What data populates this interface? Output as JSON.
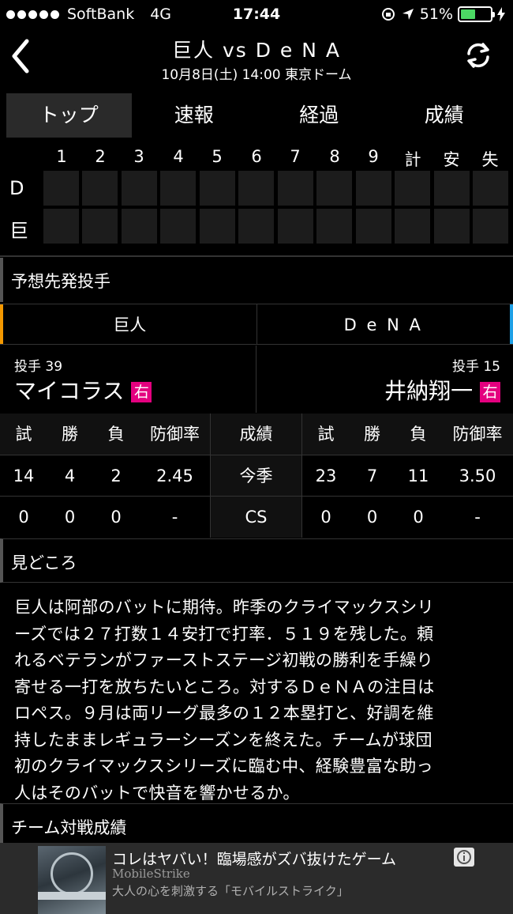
{
  "status": {
    "carrier": "SoftBank",
    "network": "4G",
    "time": "17:44",
    "battery": "51%",
    "battery_level": 0.51
  },
  "header": {
    "title": "巨人 vs D e N A",
    "subtitle": "10月8日(土) 14:00 東京ドーム"
  },
  "tabs": [
    "トップ",
    "速報",
    "経過",
    "成績"
  ],
  "scoreboard": {
    "columns": [
      "1",
      "2",
      "3",
      "4",
      "5",
      "6",
      "7",
      "8",
      "9",
      "計",
      "安",
      "失"
    ],
    "rows": [
      "D",
      "巨"
    ]
  },
  "pitchers_section": {
    "title": "予想先発投手"
  },
  "teams": {
    "home": "巨人",
    "away": "D e N A"
  },
  "pitchers": {
    "home": {
      "number": "投手  39",
      "name": "マイコラス",
      "hand": "右"
    },
    "away": {
      "number": "投手  15",
      "name": "井納翔一",
      "hand": "右"
    }
  },
  "stats": {
    "headers_left": [
      "試",
      "勝",
      "負",
      "防御率"
    ],
    "headers_mid": "成績",
    "headers_right": [
      "試",
      "勝",
      "負",
      "防御率"
    ],
    "rows": [
      {
        "label": "今季",
        "left": [
          "14",
          "4",
          "2",
          "2.45"
        ],
        "right": [
          "23",
          "7",
          "11",
          "3.50"
        ]
      },
      {
        "label": "CS",
        "left": [
          "0",
          "0",
          "0",
          "-"
        ],
        "right": [
          "0",
          "0",
          "0",
          "-"
        ]
      }
    ]
  },
  "highlights": {
    "title": "見どころ",
    "lines": [
      "巨人は阿部のバットに期待。昨季のクライマックスシリ",
      "ーズでは２７打数１４安打で打率．５１９を残した。頼",
      "れるベテランがファーストステージ初戦の勝利を手繰り",
      "寄せる一打を放ちたいところ。対するＤｅＮＡの注目は",
      "ロペス。９月は両リーグ最多の１２本塁打と、好調を維",
      "持したままレギュラーシーズンを終えた。チームが球団",
      "初のクライマックスシリーズに臨む中、経験豊富な助っ",
      "人はそのバットで快音を響かせるか。"
    ]
  },
  "matchup_section": {
    "title": "チーム対戦成績"
  },
  "ad": {
    "title": "コレはヤバい！臨場感がズバ抜けたゲーム",
    "brand": "MobileStrike",
    "text": "大人の心を刺激する「モバイルストライク」"
  }
}
